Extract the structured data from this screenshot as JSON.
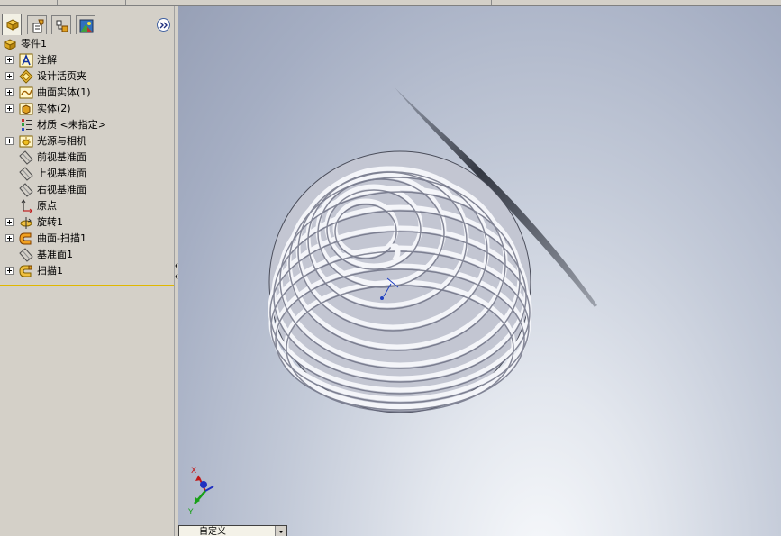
{
  "sidebar": {
    "tabs": [
      {
        "name": "FeatureManager 设计树",
        "icon": "feature-tree-icon"
      },
      {
        "name": "PropertyManager",
        "icon": "property-manager-icon"
      },
      {
        "name": "ConfigurationManager",
        "icon": "configuration-manager-icon"
      },
      {
        "name": "DisplayManager",
        "icon": "display-manager-icon"
      }
    ],
    "expand_icon": "double-chevron-right-icon",
    "tree": {
      "root": {
        "label": "零件1",
        "icon": "part-icon"
      },
      "items": [
        {
          "label": "注解",
          "icon": "annotations-icon",
          "expandable": true
        },
        {
          "label": "设计活页夹",
          "icon": "design-binder-icon",
          "expandable": true
        },
        {
          "label": "曲面实体(1)",
          "icon": "surface-bodies-icon",
          "expandable": true
        },
        {
          "label": "实体(2)",
          "icon": "solid-bodies-icon",
          "expandable": true
        },
        {
          "label": "材质 <未指定>",
          "icon": "material-icon",
          "expandable": false
        },
        {
          "label": "光源与相机",
          "icon": "lights-cameras-icon",
          "expandable": true
        },
        {
          "label": "前视基准面",
          "icon": "plane-icon",
          "expandable": false
        },
        {
          "label": "上视基准面",
          "icon": "plane-icon",
          "expandable": false
        },
        {
          "label": "右视基准面",
          "icon": "plane-icon",
          "expandable": false
        },
        {
          "label": "原点",
          "icon": "origin-icon",
          "expandable": false
        },
        {
          "label": "旋转1",
          "icon": "revolve-icon",
          "expandable": true
        },
        {
          "label": "曲面-扫描1",
          "icon": "surface-sweep-icon",
          "expandable": true
        },
        {
          "label": "基准面1",
          "icon": "plane-icon",
          "expandable": false
        },
        {
          "label": "扫描1",
          "icon": "sweep-icon",
          "expandable": true
        }
      ]
    }
  },
  "viewport": {
    "triad": {
      "x_label": "X",
      "y_label": "Y"
    },
    "view_selector": {
      "value": "自定义"
    }
  },
  "colors": {
    "rollback_bar": "#e0b800",
    "coil": "#b7bac7",
    "viewport_bg": "#a5aec3"
  }
}
